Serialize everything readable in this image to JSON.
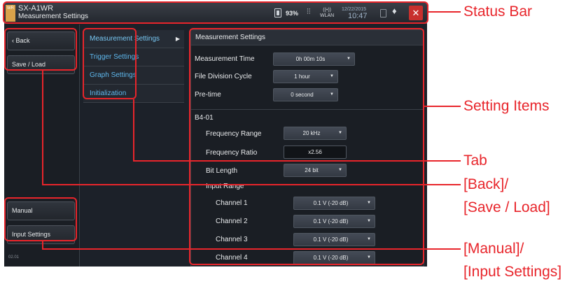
{
  "statusbar": {
    "logo_text": "WR",
    "app_name": "SX-A1WR",
    "screen_name": "Measurement Settings",
    "battery": "93%",
    "wlan_label": "WLAN",
    "date": "12/22/2015",
    "time": "10:47",
    "close_symbol": "✕"
  },
  "left_buttons": {
    "back": "Back",
    "save_load": "Save / Load",
    "manual": "Manual",
    "input_settings": "Input Settings",
    "version": "02.01"
  },
  "tabs": [
    {
      "label": "Measurement Settings"
    },
    {
      "label": "Trigger Settings"
    },
    {
      "label": "Graph Settings"
    },
    {
      "label": "Initialization"
    }
  ],
  "panel": {
    "header": "Measurement Settings",
    "measurement_time": {
      "label": "Measurement Time",
      "value": "0h 00m 10s"
    },
    "file_division": {
      "label": "File Division Cycle",
      "value": "1 hour"
    },
    "pre_time": {
      "label": "Pre-time",
      "value": "0 second"
    },
    "module": "B4-01",
    "frequency_range": {
      "label": "Frequency Range",
      "value": "20 kHz"
    },
    "frequency_ratio": {
      "label": "Frequency Ratio",
      "value": "x2.56"
    },
    "bit_length": {
      "label": "Bit Length",
      "value": "24 bit"
    },
    "input_range_label": "Input Range",
    "channels": [
      {
        "label": "Channel 1",
        "value": "0.1 V (-20 dB)"
      },
      {
        "label": "Channel 2",
        "value": "0.1 V (-20 dB)"
      },
      {
        "label": "Channel 3",
        "value": "0.1 V (-20 dB)"
      },
      {
        "label": "Channel 4",
        "value": "0.1 V (-20 dB)"
      }
    ]
  },
  "callouts": {
    "status_bar": "Status Bar",
    "setting_items": "Setting Items",
    "tab": "Tab",
    "back_1": "[Back]/",
    "back_2": "[Save / Load]",
    "manual_1": "[Manual]/",
    "manual_2": "[Input Settings]"
  },
  "colors": {
    "annotation": "#e8252b",
    "tab_text": "#5eb7ec",
    "close_button": "#c8302d",
    "screen_bg": "#1c2129"
  }
}
